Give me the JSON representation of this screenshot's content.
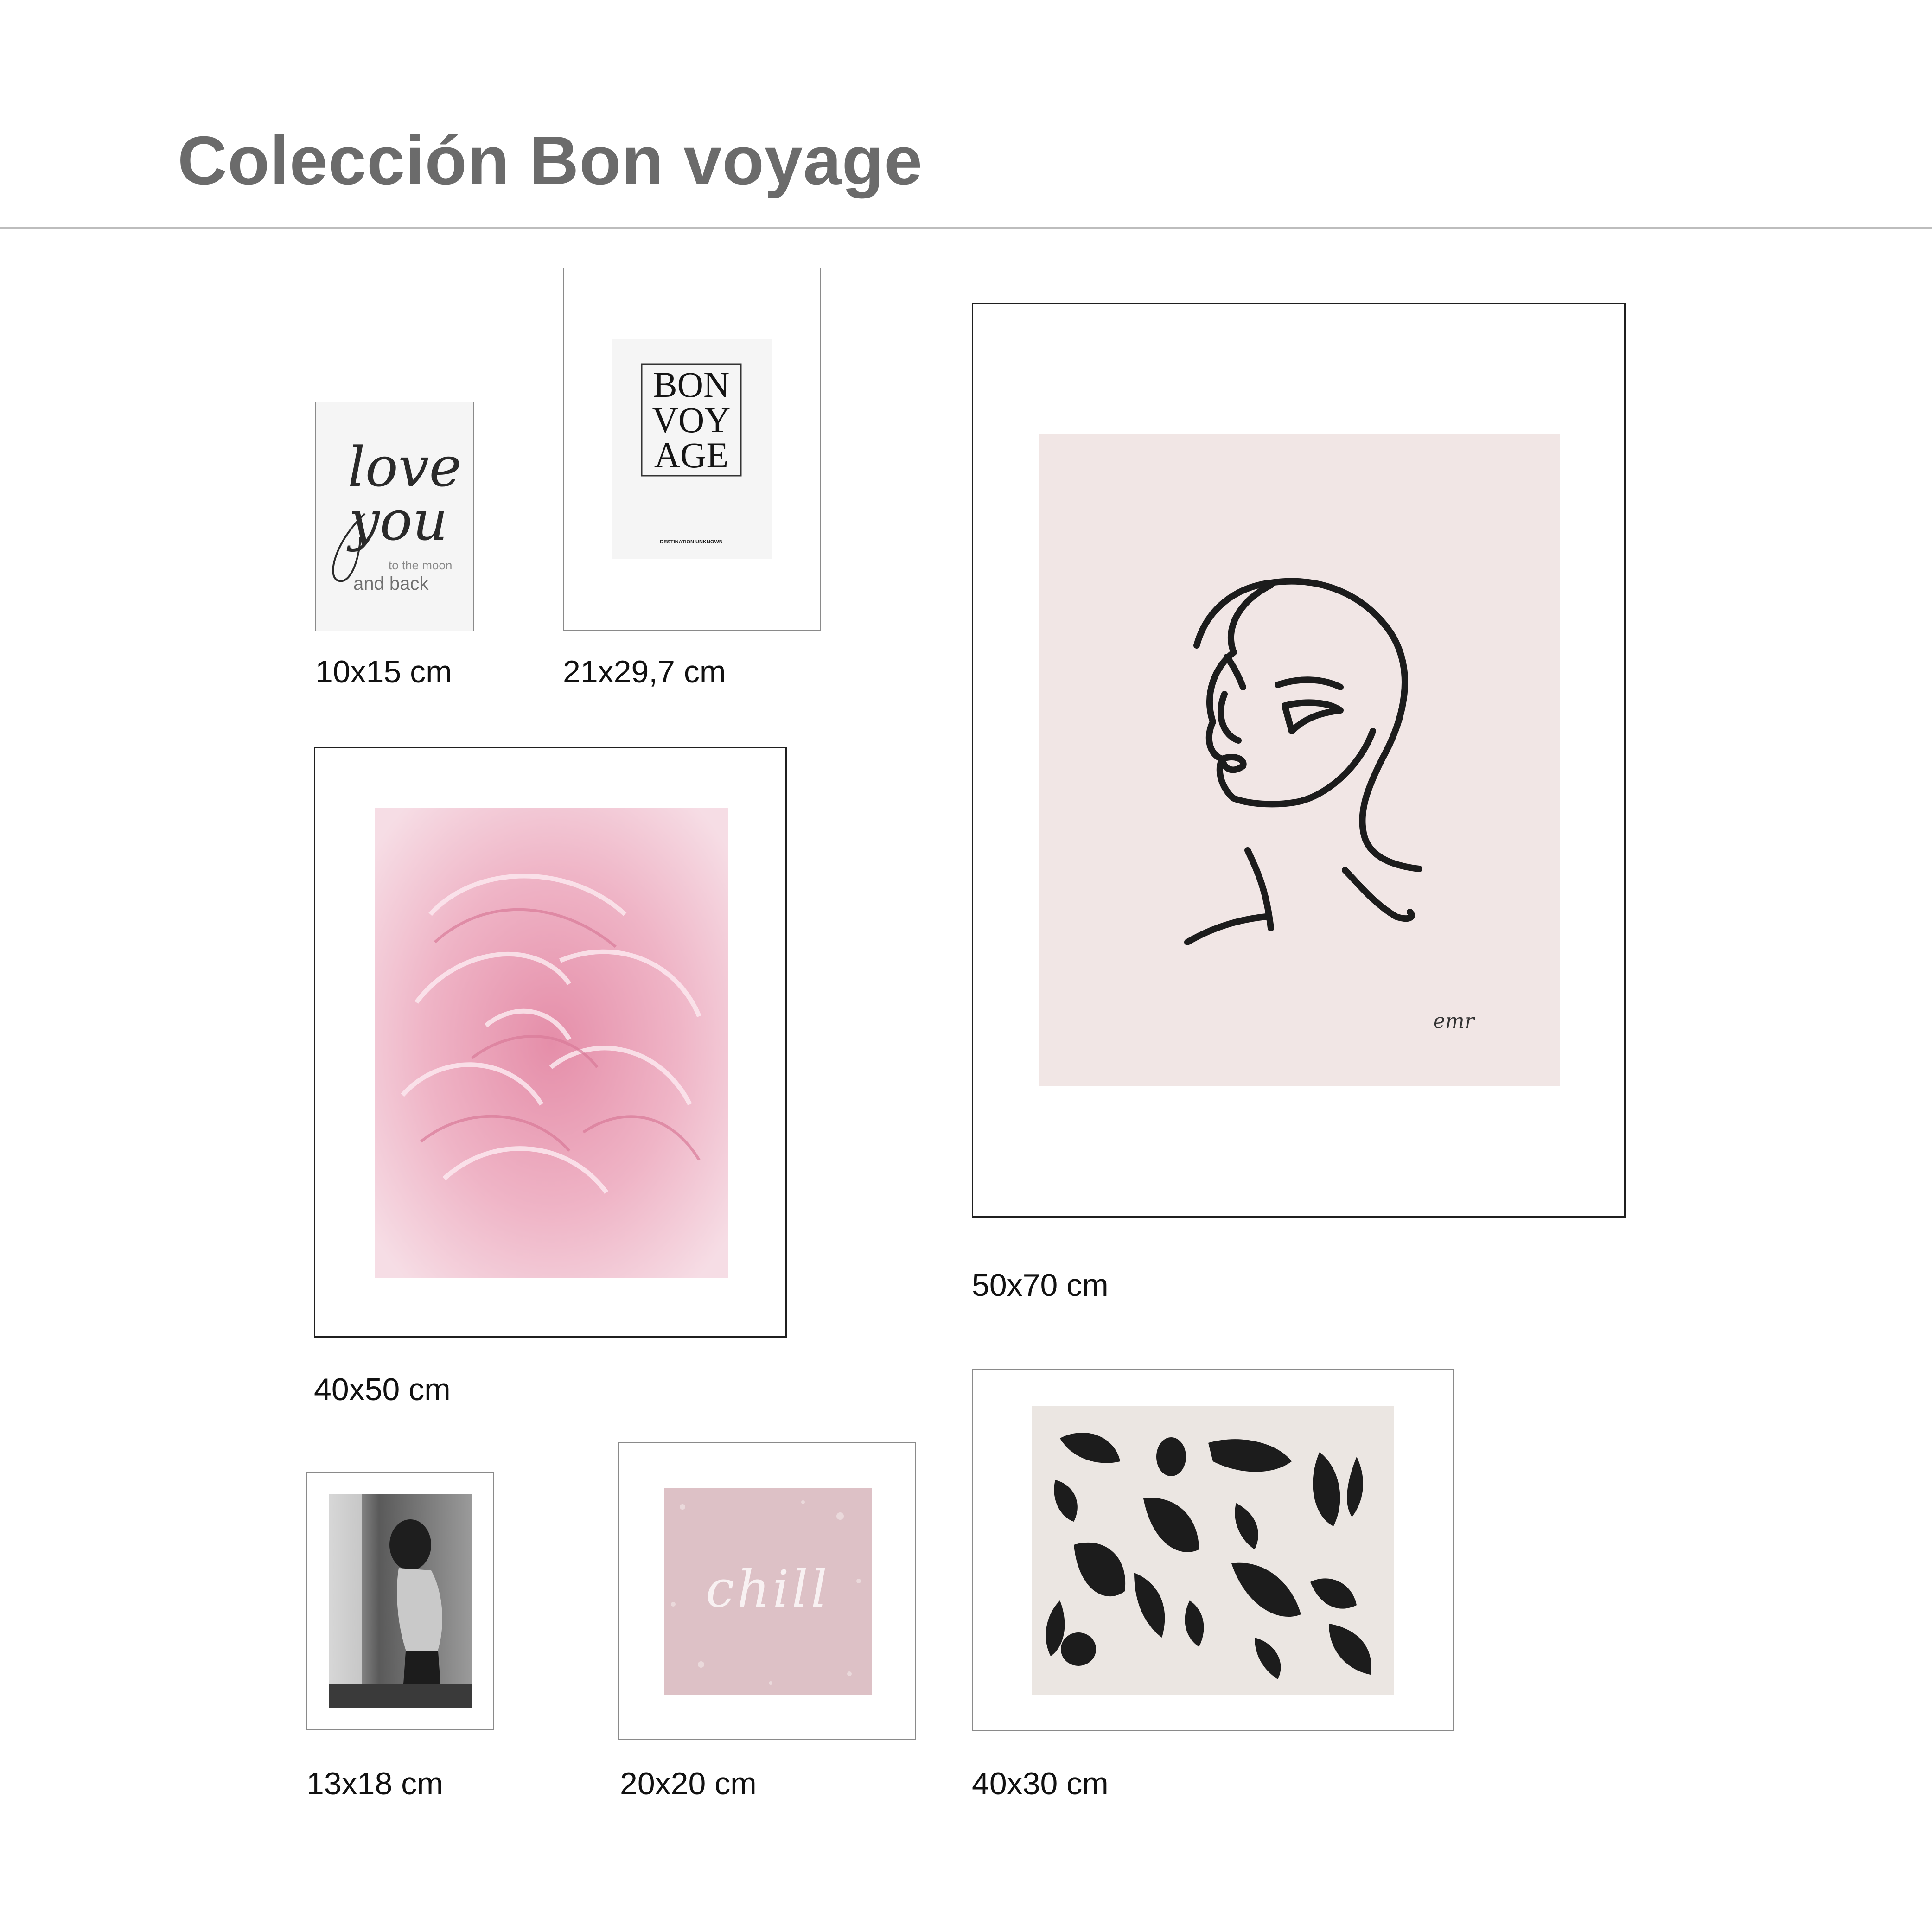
{
  "header": {
    "title": "Colección Bon voyage"
  },
  "prints": [
    {
      "id": "love-you",
      "size_label": "10x15 cm",
      "art": {
        "line1": "love",
        "line2": "you",
        "line3": "to the moon",
        "line4": "and back"
      }
    },
    {
      "id": "bon-voyage",
      "size_label": "21x29,7 cm",
      "art": {
        "line1": "BON",
        "line2": "VOY",
        "line3": "AGE",
        "caption": "DESTINATION UNKNOWN"
      }
    },
    {
      "id": "face-line-art",
      "size_label": "50x70 cm",
      "art": {
        "signature": "emr"
      }
    },
    {
      "id": "pink-peony",
      "size_label": "40x50 cm"
    },
    {
      "id": "woman-photo",
      "size_label": "13x18 cm"
    },
    {
      "id": "chill",
      "size_label": "20x20 cm",
      "art": {
        "word": "chill"
      }
    },
    {
      "id": "abstract-shapes",
      "size_label": "40x30 cm"
    }
  ],
  "colors": {
    "title": "#6b6b6b",
    "blush": "#f1e6e5",
    "dusty_pink": "#ddc1c6",
    "peony": "#e9a9bd",
    "beige": "#ebe6e2",
    "ink": "#1c1c1c"
  }
}
